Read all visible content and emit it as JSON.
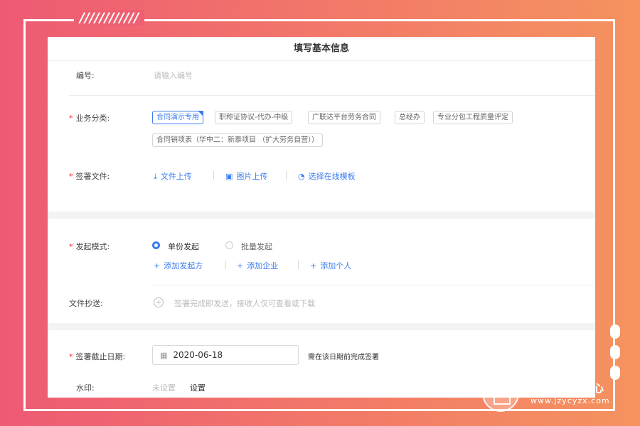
{
  "decor": {
    "slashes": "////////////"
  },
  "form": {
    "title": "填写基本信息",
    "number": {
      "label": "编号:",
      "placeholder": "请输入编号"
    },
    "category": {
      "required_mark": "*",
      "label": "业务分类:",
      "tags": [
        {
          "label": "合同演示专用",
          "active": true
        },
        {
          "label": "职称证协议-代办-中级",
          "active": false
        },
        {
          "label": "广联达平台劳务合同",
          "active": false
        },
        {
          "label": "总经办",
          "active": false
        },
        {
          "label": "专业分包工程质量评定",
          "active": false
        },
        {
          "label": "合同销项表（华中二：新泰项目 （扩大劳务自营））",
          "active": false
        }
      ]
    },
    "sign_files": {
      "required_mark": "*",
      "label": "签署文件:",
      "actions": [
        {
          "icon": "upload-icon",
          "label": "文件上传"
        },
        {
          "icon": "image-upload-icon",
          "label": "图片上传"
        },
        {
          "icon": "template-search-icon",
          "label": "选择在线模板"
        }
      ]
    },
    "initiate_mode": {
      "required_mark": "*",
      "label": "发起模式:",
      "options": [
        {
          "label": "单份发起",
          "selected": true
        },
        {
          "label": "批量发起",
          "selected": false
        }
      ],
      "add_actions": [
        {
          "label": "添加发起方"
        },
        {
          "label": "添加企业"
        },
        {
          "label": "添加个人"
        }
      ]
    },
    "cc": {
      "label": "文件抄送:",
      "placeholder": "签署完成即发送，接收人仅可查看或下载"
    },
    "deadline": {
      "required_mark": "*",
      "label": "签署截止日期:",
      "value": "2020-06-18",
      "hint": "需在该日期前完成签署"
    },
    "watermark": {
      "label": "水印:",
      "status": "未设置",
      "action": "设置"
    }
  },
  "brand": {
    "name": "建筑业产业中心",
    "url": "www.jzycyzx.com"
  },
  "colors": {
    "accent": "#3b7cf0",
    "required": "#f5222d",
    "bg_left": "#ee5a74",
    "bg_right": "#f5935f"
  }
}
